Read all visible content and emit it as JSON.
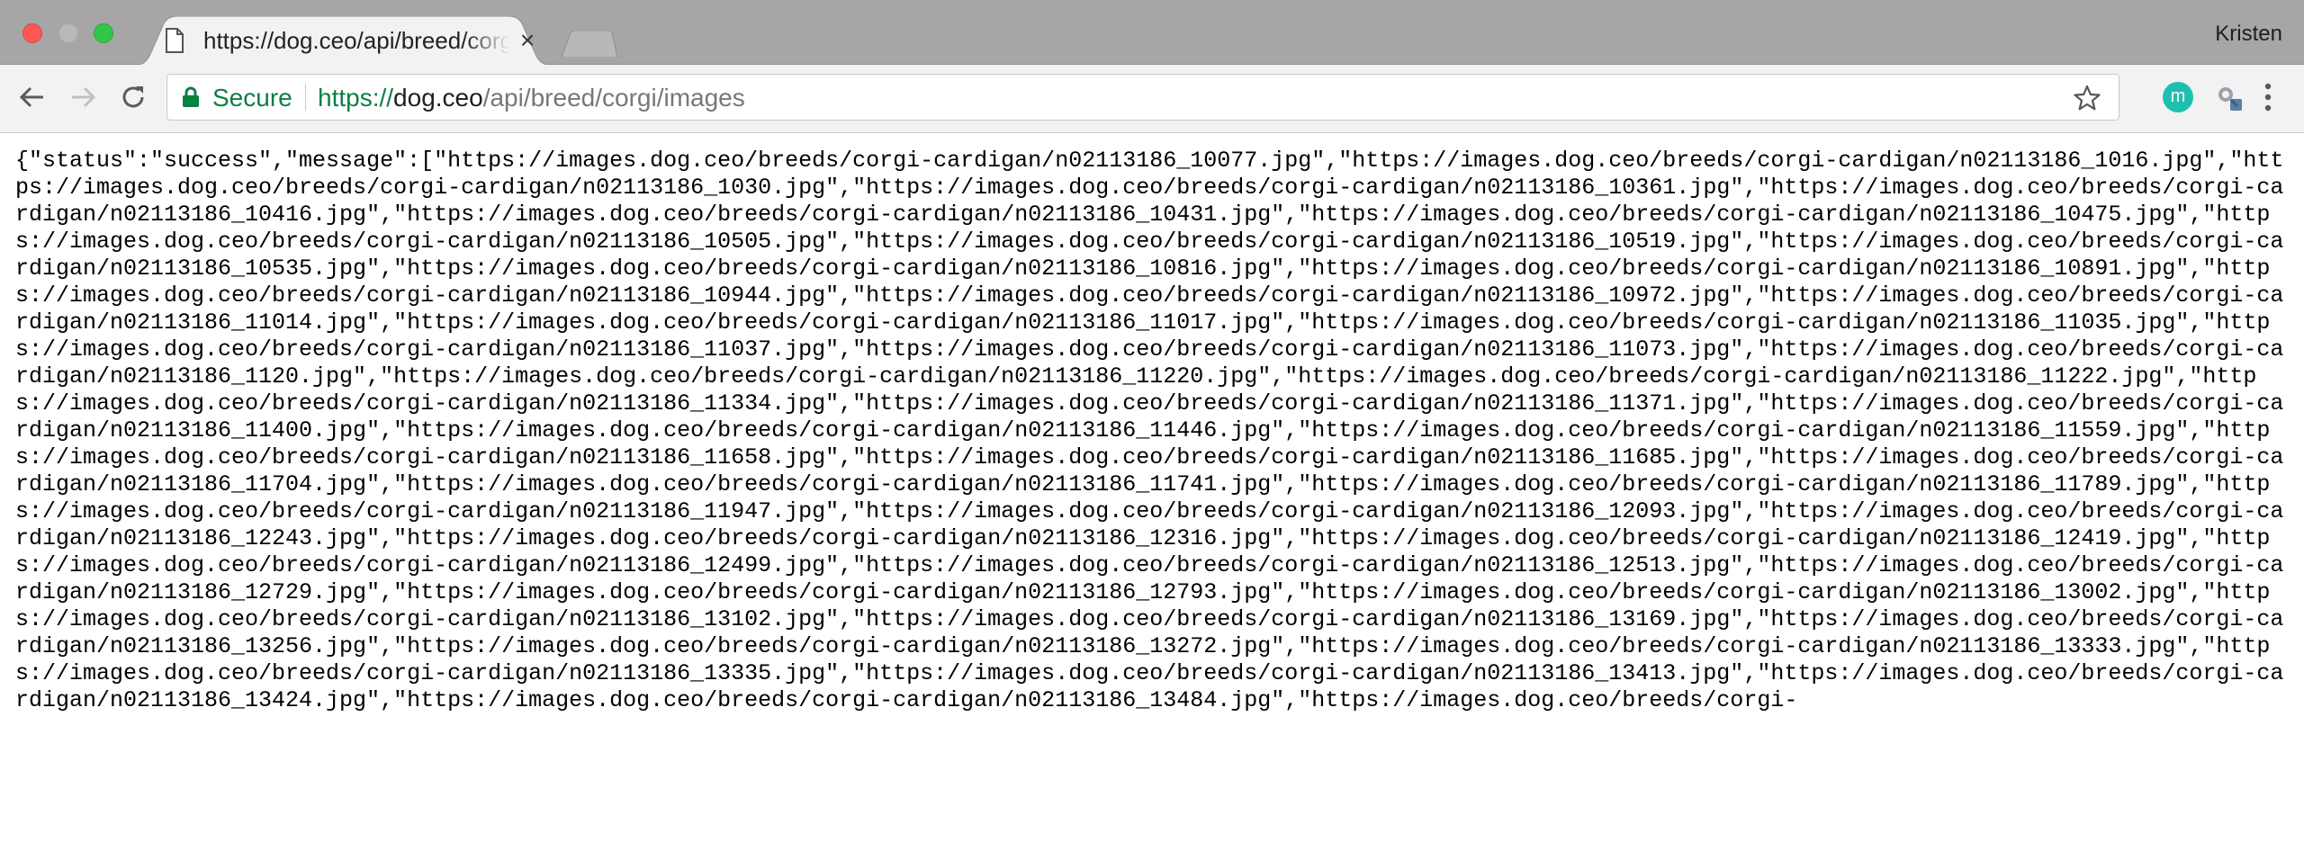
{
  "tab": {
    "title": "https://dog.ceo/api/breed/corgi/images",
    "favicon": "page-icon",
    "close_glyph": "×"
  },
  "profile": {
    "name": "Kristen"
  },
  "toolbar": {
    "back_icon": "back-arrow-icon",
    "forward_icon": "forward-arrow-icon",
    "reload_icon": "reload-icon",
    "extension_letter": "m",
    "extension_color": "#1fbfb0"
  },
  "omnibox": {
    "secure_label": "Secure",
    "url_scheme": "https://",
    "url_host": "dog.ceo",
    "url_path": "/api/breed/corgi/images",
    "secure_color": "#0b8043"
  },
  "content": {
    "lines": [
      "{\"status\":\"success\",\"message\":[\"https://images.dog.ceo/breeds/corgi-cardigan/n02113186_10077.jpg\",\"https://images.dog.ceo/breeds/corgi-",
      "cardigan/n02113186_1016.jpg\",\"https://images.dog.ceo/breeds/corgi-cardigan/n02113186_1030.jpg\",\"https://images.dog.ceo/breeds/corgi-",
      "cardigan/n02113186_10361.jpg\",\"https://images.dog.ceo/breeds/corgi-cardigan/n02113186_10416.jpg\",\"https://images.dog.ceo/breeds/corgi-",
      "cardigan/n02113186_10431.jpg\",\"https://images.dog.ceo/breeds/corgi-cardigan/n02113186_10475.jpg\",\"https://images.dog.ceo/breeds/corgi-",
      "cardigan/n02113186_10505.jpg\",\"https://images.dog.ceo/breeds/corgi-cardigan/n02113186_10519.jpg\",\"https://images.dog.ceo/breeds/corgi-",
      "cardigan/n02113186_10535.jpg\",\"https://images.dog.ceo/breeds/corgi-cardigan/n02113186_10816.jpg\",\"https://images.dog.ceo/breeds/corgi-",
      "cardigan/n02113186_10891.jpg\",\"https://images.dog.ceo/breeds/corgi-cardigan/n02113186_10944.jpg\",\"https://images.dog.ceo/breeds/corgi-",
      "cardigan/n02113186_10972.jpg\",\"https://images.dog.ceo/breeds/corgi-cardigan/n02113186_11014.jpg\",\"https://images.dog.ceo/breeds/corgi-",
      "cardigan/n02113186_11017.jpg\",\"https://images.dog.ceo/breeds/corgi-cardigan/n02113186_11035.jpg\",\"https://images.dog.ceo/breeds/corgi-",
      "cardigan/n02113186_11037.jpg\",\"https://images.dog.ceo/breeds/corgi-cardigan/n02113186_11073.jpg\",\"https://images.dog.ceo/breeds/corgi-",
      "cardigan/n02113186_1120.jpg\",\"https://images.dog.ceo/breeds/corgi-cardigan/n02113186_11220.jpg\",\"https://images.dog.ceo/breeds/corgi-",
      "cardigan/n02113186_11222.jpg\",\"https://images.dog.ceo/breeds/corgi-cardigan/n02113186_11334.jpg\",\"https://images.dog.ceo/breeds/corgi-",
      "cardigan/n02113186_11371.jpg\",\"https://images.dog.ceo/breeds/corgi-cardigan/n02113186_11400.jpg\",\"https://images.dog.ceo/breeds/corgi-",
      "cardigan/n02113186_11446.jpg\",\"https://images.dog.ceo/breeds/corgi-cardigan/n02113186_11559.jpg\",\"https://images.dog.ceo/breeds/corgi-",
      "cardigan/n02113186_11658.jpg\",\"https://images.dog.ceo/breeds/corgi-cardigan/n02113186_11685.jpg\",\"https://images.dog.ceo/breeds/corgi-",
      "cardigan/n02113186_11704.jpg\",\"https://images.dog.ceo/breeds/corgi-cardigan/n02113186_11741.jpg\",\"https://images.dog.ceo/breeds/corgi-",
      "cardigan/n02113186_11789.jpg\",\"https://images.dog.ceo/breeds/corgi-cardigan/n02113186_11947.jpg\",\"https://images.dog.ceo/breeds/corgi-",
      "cardigan/n02113186_12093.jpg\",\"https://images.dog.ceo/breeds/corgi-cardigan/n02113186_12243.jpg\",\"https://images.dog.ceo/breeds/corgi-",
      "cardigan/n02113186_12316.jpg\",\"https://images.dog.ceo/breeds/corgi-cardigan/n02113186_12419.jpg\",\"https://images.dog.ceo/breeds/corgi-",
      "cardigan/n02113186_12499.jpg\",\"https://images.dog.ceo/breeds/corgi-cardigan/n02113186_12513.jpg\",\"https://images.dog.ceo/breeds/corgi-",
      "cardigan/n02113186_12729.jpg\",\"https://images.dog.ceo/breeds/corgi-cardigan/n02113186_12793.jpg\",\"https://images.dog.ceo/breeds/corgi-",
      "cardigan/n02113186_13002.jpg\",\"https://images.dog.ceo/breeds/corgi-cardigan/n02113186_13102.jpg\",\"https://images.dog.ceo/breeds/corgi-",
      "cardigan/n02113186_13169.jpg\",\"https://images.dog.ceo/breeds/corgi-cardigan/n02113186_13256.jpg\",\"https://images.dog.ceo/breeds/corgi-",
      "cardigan/n02113186_13272.jpg\",\"https://images.dog.ceo/breeds/corgi-cardigan/n02113186_13333.jpg\",\"https://images.dog.ceo/breeds/corgi-",
      "cardigan/n02113186_13335.jpg\",\"https://images.dog.ceo/breeds/corgi-cardigan/n02113186_13413.jpg\",\"https://images.dog.ceo/breeds/corgi-",
      "cardigan/n02113186_13424.jpg\",\"https://images.dog.ceo/breeds/corgi-cardigan/n02113186_13484.jpg\",\"https://images.dog.ceo/breeds/corgi-"
    ]
  }
}
